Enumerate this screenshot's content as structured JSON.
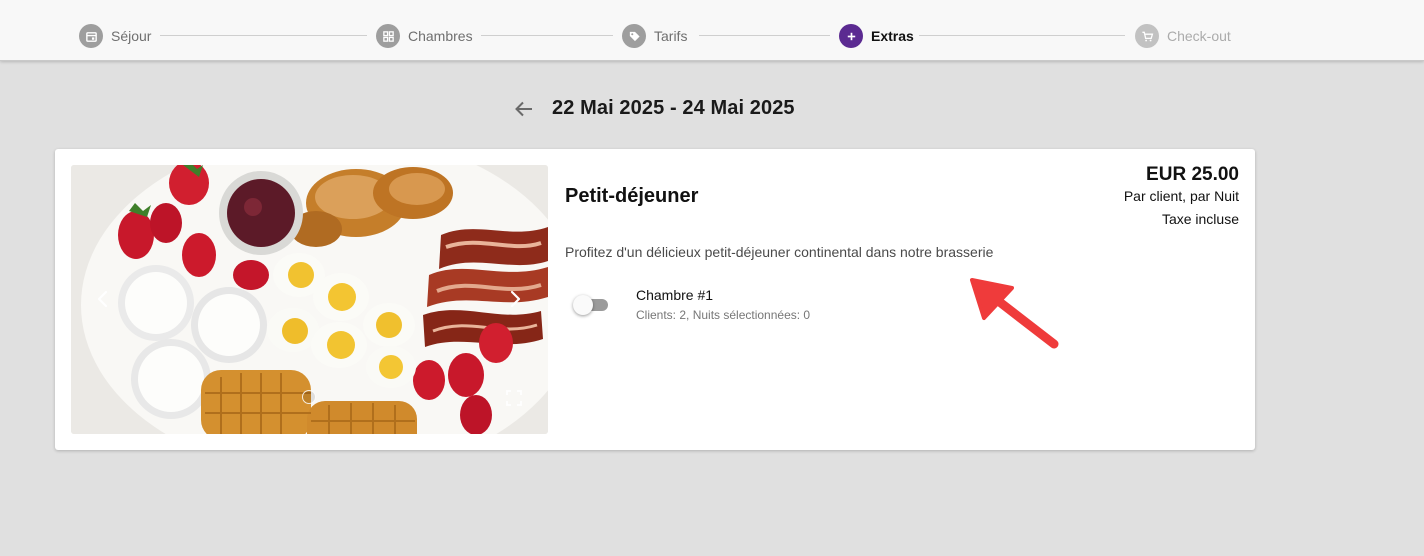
{
  "stepper": {
    "steps": [
      {
        "label": "Séjour",
        "icon": "calendar-icon",
        "state": "done"
      },
      {
        "label": "Chambres",
        "icon": "grid-icon",
        "state": "done"
      },
      {
        "label": "Tarifs",
        "icon": "tag-icon",
        "state": "done"
      },
      {
        "label": "Extras",
        "icon": "plus-icon",
        "state": "active"
      },
      {
        "label": "Check-out",
        "icon": "cart-icon",
        "state": "disabled"
      }
    ]
  },
  "header": {
    "date_range": "22 Mai 2025 - 24 Mai 2025"
  },
  "extra": {
    "title": "Petit-déjeuner",
    "price": "EUR 25.00",
    "price_unit": "Par client, par Nuit",
    "tax": "Taxe incluse",
    "description": "Profitez d'un délicieux petit-déjeuner continental dans notre brasserie",
    "room": {
      "name": "Chambre #1",
      "info": "Clients: 2, Nuits sélectionnées: 0",
      "selected": false
    }
  },
  "colors": {
    "accent": "#5b2a91",
    "page_bg": "#e0e0e0",
    "annotation": "#ef3b3b"
  }
}
